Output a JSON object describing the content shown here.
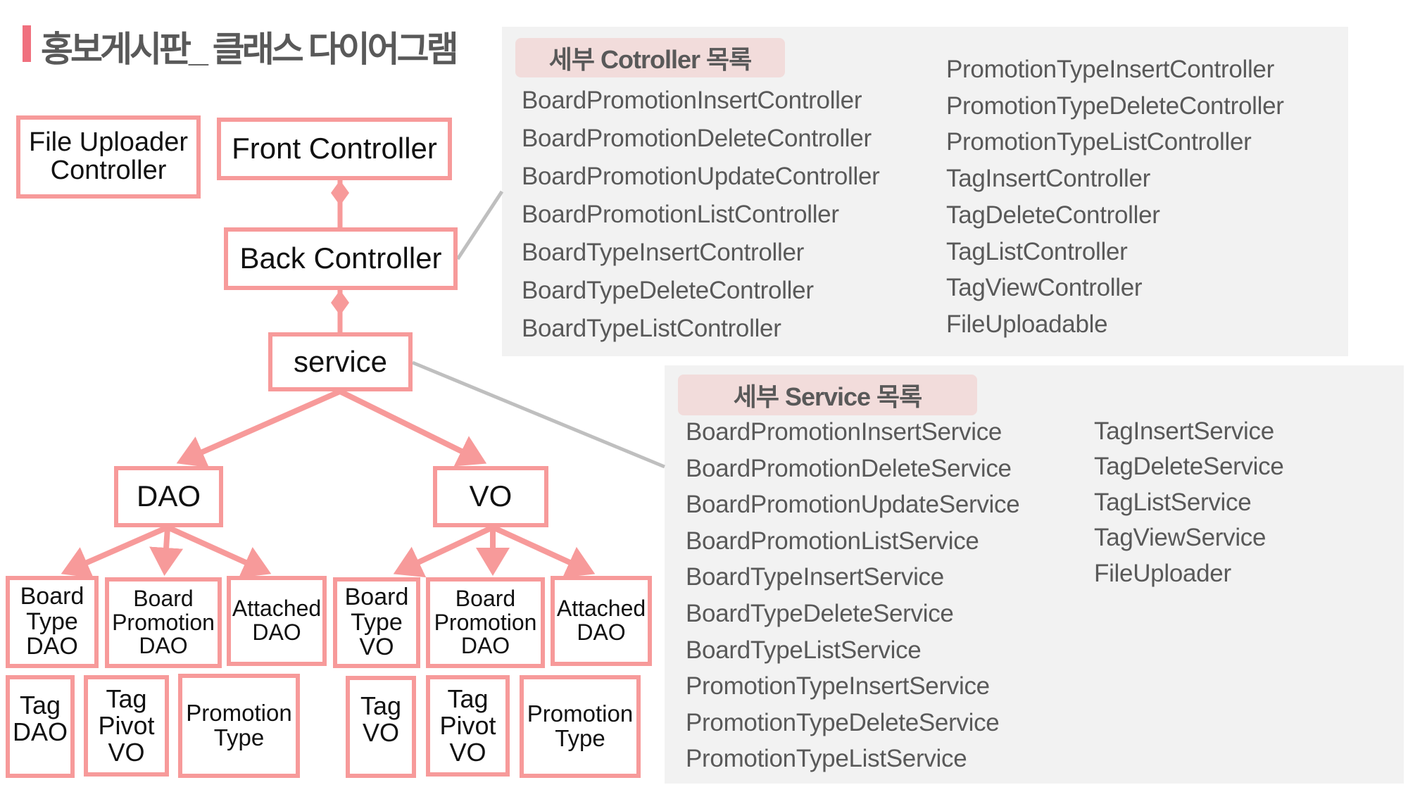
{
  "title": "홍보게시판_ 클래스 다이어그램",
  "colors": {
    "accent": "#F0707E",
    "box_border": "#F79A9A",
    "panel": "#F2F2F2",
    "pill": "#F2DCDB",
    "text": "#595959"
  },
  "boxes": {
    "file_uploader": "File Uploader\nController",
    "front_controller": "Front Controller",
    "back_controller": "Back Controller",
    "service": "service",
    "dao": "DAO",
    "vo": "VO",
    "dao_children": [
      "Board\nType\nDAO",
      "Board\nPromotion\nDAO",
      "Attached\nDAO",
      "Tag\nDAO",
      "Tag\nPivot\nVO",
      "Promotion\nType"
    ],
    "vo_children": [
      "Board\nType\nVO",
      "Board\nPromotion\nDAO",
      "Attached\nDAO",
      "Tag\nVO",
      "Tag\nPivot\nVO",
      "Promotion\nType"
    ]
  },
  "controller_panel": {
    "header": "세부 Cotroller 목록",
    "left": [
      "BoardPromotionInsertController",
      "BoardPromotionDeleteController",
      "BoardPromotionUpdateController",
      "BoardPromotionListController",
      "BoardTypeInsertController",
      "BoardTypeDeleteController",
      "BoardTypeListController"
    ],
    "right": [
      "PromotionTypeInsertController",
      "PromotionTypeDeleteController",
      "PromotionTypeListController",
      "TagInsertController",
      "TagDeleteController",
      "TagListController",
      "TagViewController",
      "FileUploadable"
    ]
  },
  "service_panel": {
    "header": "세부 Service 목록",
    "left": [
      "BoardPromotionInsertService",
      "BoardPromotionDeleteService",
      "BoardPromotionUpdateService",
      "BoardPromotionListService",
      "BoardTypeInsertService",
      "BoardTypeDeleteService",
      "BoardTypeListService",
      "PromotionTypeInsertService",
      "PromotionTypeDeleteService",
      "PromotionTypeListService"
    ],
    "right": [
      "TagInsertService",
      "TagDeleteService",
      "TagListService",
      "TagViewService",
      "FileUploader"
    ]
  }
}
